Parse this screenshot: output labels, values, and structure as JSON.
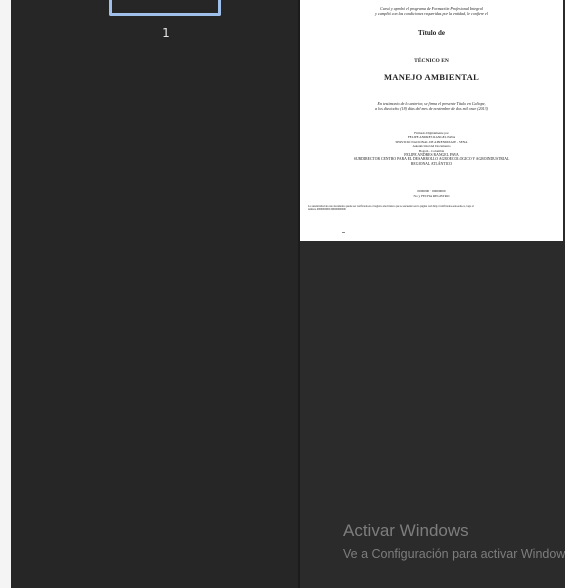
{
  "thumbnail_panel": {
    "page_number": "1"
  },
  "document_page": {
    "intro_lines": [
      "Cursó y aprobó el programa de Formación Profesional Integral",
      "y cumplió con las condiciones requeridas por la entidad, le confiere el"
    ],
    "title": "Título de",
    "tecnico_label": "TÉCNICO EN",
    "program_name": "MANEJO AMBIENTAL",
    "testimony_lines": [
      "En testimonio de lo anterior, se firma el presente Título en Caliope,",
      "a los dieciocho (18) días del mes de noviembre de dos mil once (2013)"
    ],
    "signature_lines": [
      "Firmado Digitalmente por",
      "FELIPE ANDRES RANGEL PAVA",
      "SERVICIO NACIONAL DE APRENDIZAJE - SENA",
      "Autenticidad del Documento",
      "Bogotá - Colombia"
    ],
    "signer_name": "FELIPE ANDRES RANGEL PAVA",
    "signer_role": "SUBDIRECTOR CENTRO PARA EL DESARROLLO AGROECOLOGICO Y AGROINDUSTRIAL",
    "signer_region": "REGIONAL ATLÁNTICO",
    "serial_code": "0000000 · 00000000",
    "registry_line": "No y FECHA REGISTRO",
    "verification_lines": [
      "La autenticidad de este documento puede ser verificada en el registro electrónico que se encuentra en la página web http://certificados.sena.edu.co, bajo el",
      "número 0000000000 00000000000"
    ]
  },
  "watermark": {
    "title": "Activar Windows",
    "subtitle": "Ve a Configuración para activar Windows."
  },
  "colors": {
    "left_pane": "#262626",
    "right_pane": "#2b2b2b",
    "thumbnail_selection": "#9fc0ea",
    "watermark_text": "#7d7d7d"
  }
}
